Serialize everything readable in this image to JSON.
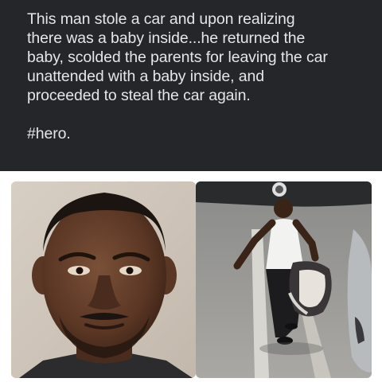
{
  "post": {
    "text": "This man stole a car and upon realizing\nthere was a baby inside...he returned the\nbaby, scolded the parents for leaving the car\nunattended with a baby inside, and\nproceeded to steal the car again.",
    "hashtag": "#hero.",
    "background_color": "#252629",
    "text_color": "#e4e6eb"
  },
  "images": [
    {
      "name": "mugshot-photo",
      "icon": "portrait-photo"
    },
    {
      "name": "surveillance-photo",
      "icon": "cctv-photo"
    }
  ]
}
